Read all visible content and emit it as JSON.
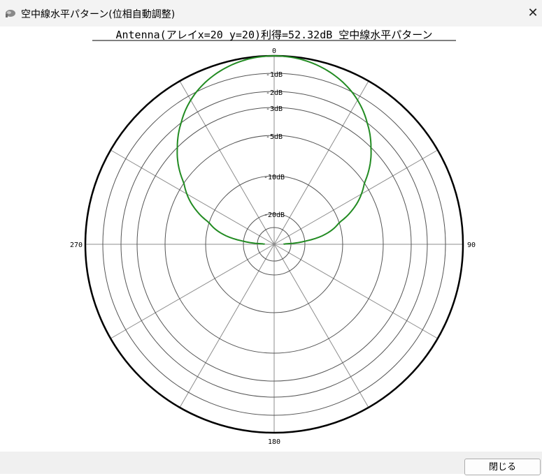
{
  "window": {
    "title": "空中線水平パターン(位相自動調整)",
    "close_glyph": "✕"
  },
  "footer": {
    "close_label": "閉じる"
  },
  "chart_data": {
    "type": "polar",
    "title": "Antenna(アレイx=20 y=20)利得=52.32dB 空中線水平パターン",
    "angle_labels": [
      "0",
      "90",
      "180",
      "270"
    ],
    "ring_labels": [
      "-1dB",
      "-2dB",
      "-3dB",
      "-5dB",
      "-10dB",
      "-20dB"
    ],
    "ring_db": [
      0,
      -1,
      -2,
      -3,
      -5,
      -10,
      -20
    ],
    "spoke_step_deg": 30,
    "series": [
      {
        "shape": "main-lobe",
        "peak_db": 0,
        "null_db": -30,
        "half_width_deg": 90,
        "color": "#228b22"
      }
    ],
    "grid": true
  }
}
